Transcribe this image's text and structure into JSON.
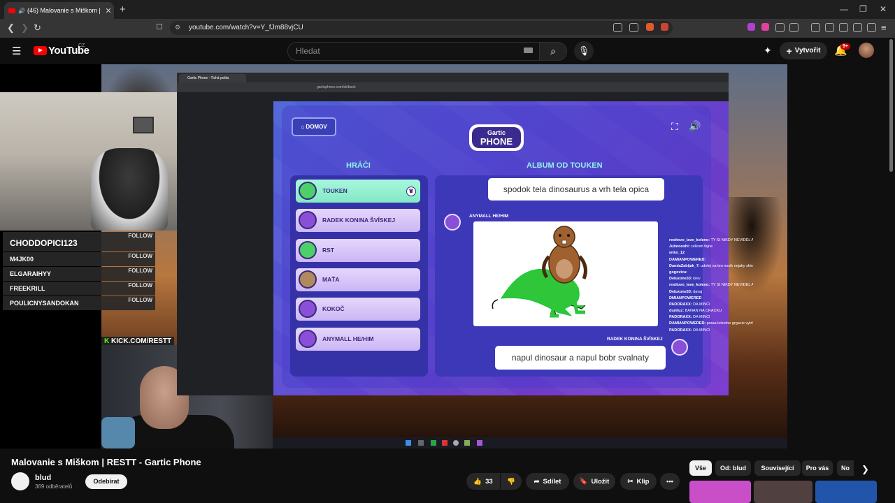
{
  "browser": {
    "tab_title": "(46) Malovanie s Miškom | RE",
    "url": "youtube.com/watch?v=Y_fJm88vjCU"
  },
  "youtube": {
    "logo_text": "YouTube",
    "country": "CZ",
    "search_placeholder": "Hledat",
    "create_label": "Vytvořit",
    "notifications_badge": "9+"
  },
  "stream": {
    "followers": [
      {
        "name": "CHODDOPICI123",
        "action": "FOLLOW"
      },
      {
        "name": "M4JK00",
        "action": "FOLLOW"
      },
      {
        "name": "ELGARAIHYY",
        "action": "FOLLOW"
      },
      {
        "name": "FREEKRILL",
        "action": "FOLLOW"
      },
      {
        "name": "POULICNYSANDOKAN",
        "action": "FOLLOW"
      }
    ],
    "kick_url": "KICK.COM/RESTT"
  },
  "inner_browser": {
    "tab_title": "Gartic Phone - Tichá pošta",
    "url": "garticphone.com/sk/book"
  },
  "game": {
    "home_label": "DOMOV",
    "logo_top": "Gartic",
    "logo_bottom": "PHONE",
    "players_title": "HRÁČI",
    "album_title": "ALBUM OD TOUKEN",
    "players": [
      {
        "name": "TOUKEN",
        "highlight": true
      },
      {
        "name": "RADEK KONINA ŠVÍSKEJ",
        "highlight": false
      },
      {
        "name": "RST",
        "highlight": false
      },
      {
        "name": "MAŤA",
        "highlight": false
      },
      {
        "name": "KOKOČ",
        "highlight": false
      },
      {
        "name": "ANYMALL HE/HIM",
        "highlight": false
      }
    ],
    "album": {
      "text1": "spodok tela dinosaurus a vrh tela opica",
      "drawer": "ANYMALL HE/HIM",
      "guesser": "RADEK KONINA ŠVÍSKEJ",
      "text2": "napul dinosaur a napul bobr svalnaty"
    }
  },
  "chat": [
    {
      "user": "resttovo_lave_koleno:",
      "msg": "TY SI NIKDY NEVIDEL ANANAS?"
    },
    {
      "user": "Juboooshi:",
      "msg": "celkom fajne"
    },
    {
      "user": "enko_12",
      "msg": ""
    },
    {
      "user": "DAMIANPOWERED:",
      "msg": ""
    },
    {
      "user": "DandaZabijak_7:",
      "msg": "udelej na ten nozik nejaky skin"
    },
    {
      "user": "gogovica:",
      "msg": ""
    },
    {
      "user": "Deluxone33:",
      "msg": "krev"
    },
    {
      "user": "resttovo_lave_koleno:",
      "msg": "TY SI NIKDY NEVIDEL ANANAS?"
    },
    {
      "user": "Deluxone33:",
      "msg": "davaj"
    },
    {
      "user": "DMIANPOWERED",
      "msg": ""
    },
    {
      "user": "PADORAXX:",
      "msg": "DA MINCI"
    },
    {
      "user": "duniluz:",
      "msg": "BANAN NA CRACKU"
    },
    {
      "user": "PADORAXX:",
      "msg": "DA MINCI"
    },
    {
      "user": "DAMIANPOWERED:",
      "msg": "prasa kokotne grgacie vytrhane"
    },
    {
      "user": "PADORAXX:",
      "msg": "DA MINCI"
    }
  ],
  "video": {
    "title": "Malovanie s Miškom | RESTT - Gartic Phone",
    "channel": "blud",
    "subscribers": "369 odběratelů",
    "subscribe_label": "Odebírat",
    "likes": "33",
    "share_label": "Sdílet",
    "save_label": "Uložit",
    "clip_label": "Klip"
  },
  "chips": [
    "Vše",
    "Od: blud",
    "Související",
    "Pro vás",
    "No"
  ]
}
